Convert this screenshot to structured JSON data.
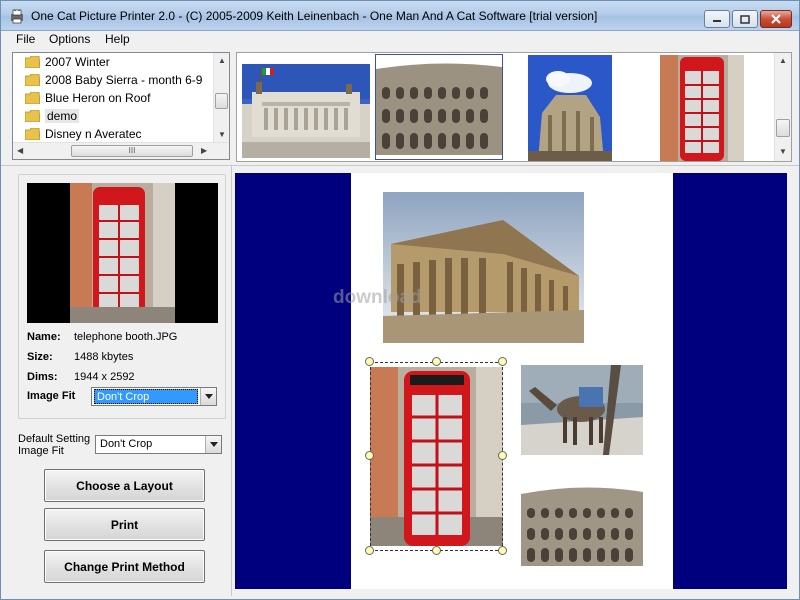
{
  "window": {
    "title": "One Cat Picture Printer 2.0 - (C) 2005-2009 Keith Leinenbach - One Man And A Cat Software [trial version]"
  },
  "menu": [
    "File",
    "Options",
    "Help"
  ],
  "folders": [
    "2007 Winter",
    "2008 Baby Sierra - month 6-9",
    "Blue Heron on Roof",
    "demo",
    "Disney n Averatec"
  ],
  "file_info": {
    "name_label": "Name:",
    "name_value": "telephone booth.JPG",
    "size_label": "Size:",
    "size_value": "1488 kbytes",
    "dims_label": "Dims:",
    "dims_value": "1944 x 2592",
    "fit_label": "Image Fit",
    "fit_value": "Don't Crop"
  },
  "default_setting": {
    "label_line1": "Default Setting",
    "label_line2": "Image Fit",
    "value": "Don't Crop"
  },
  "buttons": {
    "layout": "Choose a Layout",
    "print": "Print",
    "method": "Change Print Method"
  },
  "watermark": "download",
  "scroll_labels": {
    "hthumb": "III"
  },
  "colors": {
    "print_background": "#00007f",
    "title_bar": "#b3cce9",
    "selection": "#3399ff"
  }
}
